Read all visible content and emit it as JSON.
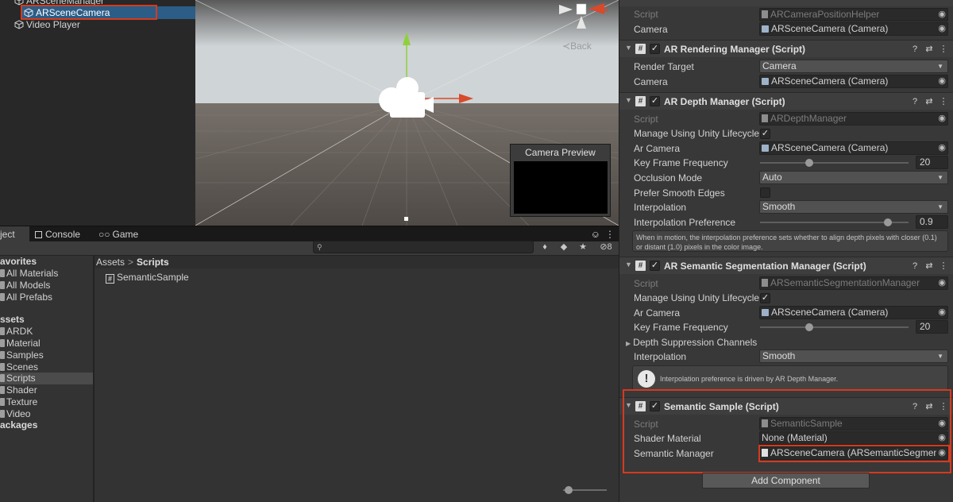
{
  "hierarchy": {
    "items": [
      {
        "label": "ARSceneManager"
      },
      {
        "label": "ARSceneCamera"
      },
      {
        "label": "Video Player"
      }
    ]
  },
  "scene": {
    "back_label": "Back",
    "gizmo_x_label": "x",
    "camera_preview_title": "Camera Preview"
  },
  "project": {
    "tabs": [
      {
        "label": "ject"
      },
      {
        "label": "Console"
      },
      {
        "label": "Game"
      }
    ],
    "hidden_count": "8",
    "sidebar": [
      {
        "label": "avorites",
        "bold": true
      },
      {
        "label": "All Materials"
      },
      {
        "label": "All Models"
      },
      {
        "label": "All Prefabs"
      },
      {
        "label": "ssets",
        "bold": true
      },
      {
        "label": "ARDK"
      },
      {
        "label": "Material"
      },
      {
        "label": "Samples"
      },
      {
        "label": "Scenes"
      },
      {
        "label": "Scripts",
        "selected": true
      },
      {
        "label": "Shader"
      },
      {
        "label": "Texture"
      },
      {
        "label": "Video"
      },
      {
        "label": "ackages",
        "bold": true
      }
    ],
    "breadcrumb": {
      "root": "Assets",
      "separator": ">",
      "current": "Scripts"
    },
    "assets": [
      {
        "label": "SemanticSample"
      }
    ]
  },
  "inspector": {
    "top": {
      "script_label": "Script",
      "script_value": "ARCameraPositionHelper",
      "camera_label": "Camera",
      "camera_value": "ARSceneCamera (Camera)"
    },
    "rendering": {
      "title": "AR Rendering Manager (Script)",
      "render_target_label": "Render Target",
      "render_target_value": "Camera",
      "camera_label": "Camera",
      "camera_value": "ARSceneCamera (Camera)"
    },
    "depth": {
      "title": "AR Depth Manager (Script)",
      "script_label": "Script",
      "script_value": "ARDepthManager",
      "lifecycle_label": "Manage Using Unity Lifecycle",
      "ar_camera_label": "Ar Camera",
      "ar_camera_value": "ARSceneCamera (Camera)",
      "key_frame_label": "Key Frame Frequency",
      "key_frame_value": "20",
      "occlusion_label": "Occlusion Mode",
      "occlusion_value": "Auto",
      "smooth_edges_label": "Prefer Smooth Edges",
      "interpolation_label": "Interpolation",
      "interpolation_value": "Smooth",
      "interp_pref_label": "Interpolation Preference",
      "interp_pref_value": "0.9",
      "help_text": "When in motion, the interpolation preference sets whether to align depth pixels with closer (0.1) or distant (1.0) pixels in the color image."
    },
    "segmentation": {
      "title": "AR Semantic Segmentation Manager (Script)",
      "script_label": "Script",
      "script_value": "ARSemanticSegmentationManager",
      "lifecycle_label": "Manage Using Unity Lifecycle",
      "ar_camera_label": "Ar Camera",
      "ar_camera_value": "ARSceneCamera (Camera)",
      "key_frame_label": "Key Frame Frequency",
      "key_frame_value": "20",
      "suppression_label": "Depth Suppression Channels",
      "interpolation_label": "Interpolation",
      "interpolation_value": "Smooth",
      "warning_text": "Interpolation preference is driven by AR Depth Manager."
    },
    "semantic_sample": {
      "title": "Semantic Sample (Script)",
      "script_label": "Script",
      "script_value": "SemanticSample",
      "shader_label": "Shader Material",
      "shader_value": "None (Material)",
      "manager_label": "Semantic Manager",
      "manager_value": "ARSceneCamera (ARSemanticSegment"
    },
    "add_component": "Add Component",
    "checkmark": "✓"
  },
  "colors": {
    "highlight_outline": "#d63a1e",
    "selection": "#2c5d87",
    "gizmo_y": "#8ed13b",
    "gizmo_x": "#d9492b"
  },
  "icons": {
    "help": "help-icon",
    "preset": "preset-icon",
    "menu": "kebab-menu-icon",
    "lock": "lock-icon",
    "search": "search-icon",
    "hash": "script-icon"
  }
}
